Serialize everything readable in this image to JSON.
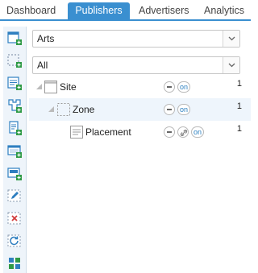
{
  "tabs": [
    {
      "label": "Dashboard"
    },
    {
      "label": "Publishers"
    },
    {
      "label": "Advertisers"
    },
    {
      "label": "Analytics"
    }
  ],
  "toolbar": {
    "icons": [
      "add-site-icon",
      "add-zone-icon",
      "add-placement-icon",
      "hierarchy-icon",
      "add-page-icon",
      "add-banner-icon",
      "add-block-icon",
      "edit-icon",
      "delete-icon",
      "refresh-icon",
      "grid-icon"
    ]
  },
  "filters": {
    "category": {
      "value": "Arts"
    },
    "status": {
      "value": "All"
    }
  },
  "tree": [
    {
      "label": "Site",
      "toggle": "on",
      "count": "1"
    },
    {
      "label": "Zone",
      "toggle": "on",
      "count": "1"
    },
    {
      "label": "Placement",
      "toggle": "on",
      "count": "1"
    }
  ],
  "colors": {
    "accent": "#3a8fd0",
    "icon_green": "#2f9a46",
    "icon_blue": "#2f7fc0",
    "icon_red": "#d23b3b"
  }
}
